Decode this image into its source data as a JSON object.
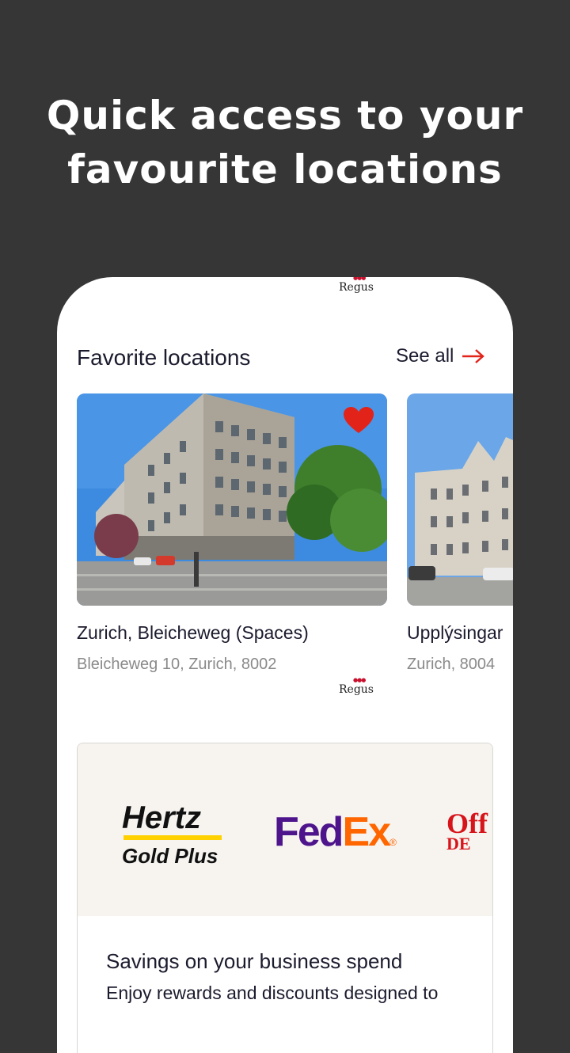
{
  "headline": {
    "line1": "Quick access to your",
    "line2": "favourite locations"
  },
  "brand": {
    "logo_text": "Regus"
  },
  "favorites": {
    "title": "Favorite locations",
    "see_all_label": "See all",
    "locations": [
      {
        "name": "Zurich, Bleicheweg (Spaces)",
        "address": "Bleicheweg 10, Zurich, 8002",
        "favorited": true
      },
      {
        "name": "Upplýsingar",
        "address": "Zurich, 8004",
        "favorited": false
      }
    ]
  },
  "promo": {
    "partners": {
      "hertz_line1": "Hertz",
      "hertz_line2": "Gold Plus",
      "fedex_fed": "Fed",
      "fedex_ex": "Ex",
      "fedex_mark": "®",
      "office_line1": "Off",
      "office_line2": "DE"
    },
    "title": "Savings on your business spend",
    "body": "Enjoy rewards and discounts designed to"
  },
  "colors": {
    "background": "#363636",
    "accent_red": "#e2231a",
    "fedex_purple": "#4d148c",
    "fedex_orange": "#ff6600",
    "hertz_yellow": "#ffd100"
  }
}
